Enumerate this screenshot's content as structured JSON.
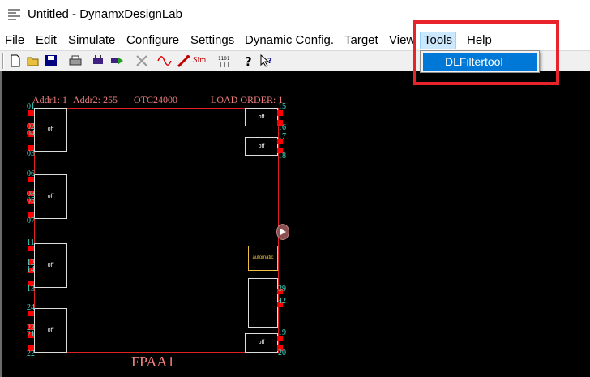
{
  "window": {
    "title": "Untitled - DynamxDesignLab"
  },
  "menu": {
    "items": [
      {
        "accel": "F",
        "rest": "ile"
      },
      {
        "accel": "E",
        "rest": "dit"
      },
      {
        "accel": "",
        "rest": "Simulate"
      },
      {
        "accel": "C",
        "rest": "onfigure"
      },
      {
        "accel": "S",
        "rest": "ettings"
      },
      {
        "accel": "D",
        "rest": "ynamic Config."
      },
      {
        "accel": "",
        "rest": "Target"
      },
      {
        "accel": "",
        "rest": "View"
      },
      {
        "accel": "T",
        "rest": "ools"
      },
      {
        "accel": "H",
        "rest": "elp"
      }
    ],
    "tools_dropdown": {
      "items": [
        "DLFiltertool"
      ]
    }
  },
  "toolbar": {
    "sim_label": "Sim",
    "buttons": [
      "new-file-icon",
      "open-folder-icon",
      "save-icon",
      "print-icon",
      "chip-icon",
      "run-icon",
      "delete-icon",
      "waveform-icon",
      "probe-icon",
      "sim-icon",
      "binary-icon",
      "help-icon",
      "context-help-icon"
    ]
  },
  "chip": {
    "addr1": "Addr1: 1",
    "addr2": "Addr2: 255",
    "model": "OTC24000",
    "load_order": "LOAD ORDER: 1",
    "name": "FPAA1",
    "blocks": [
      {
        "label": "off"
      },
      {
        "label": "off"
      },
      {
        "label": "off"
      },
      {
        "label": "off"
      },
      {
        "label": "off"
      },
      {
        "label": "off"
      },
      {
        "label": "automatic"
      },
      {
        "label": ""
      },
      {
        "label": "off"
      }
    ],
    "pins_left": [
      "01",
      "02",
      "04",
      "03",
      "06",
      "08",
      "05",
      "07",
      "11",
      "12",
      "14",
      "13",
      "24",
      "23",
      "21",
      "22"
    ],
    "pins_right": [
      "15",
      "16",
      "17",
      "18",
      "39",
      "42",
      "19",
      "20"
    ]
  },
  "colors": {
    "highlight": "#e8232b",
    "selection": "#0078d7",
    "chip_border": "#e02020",
    "pin": "#ff0000",
    "pin_label": "#40e0d0",
    "header_text": "#f08080"
  }
}
